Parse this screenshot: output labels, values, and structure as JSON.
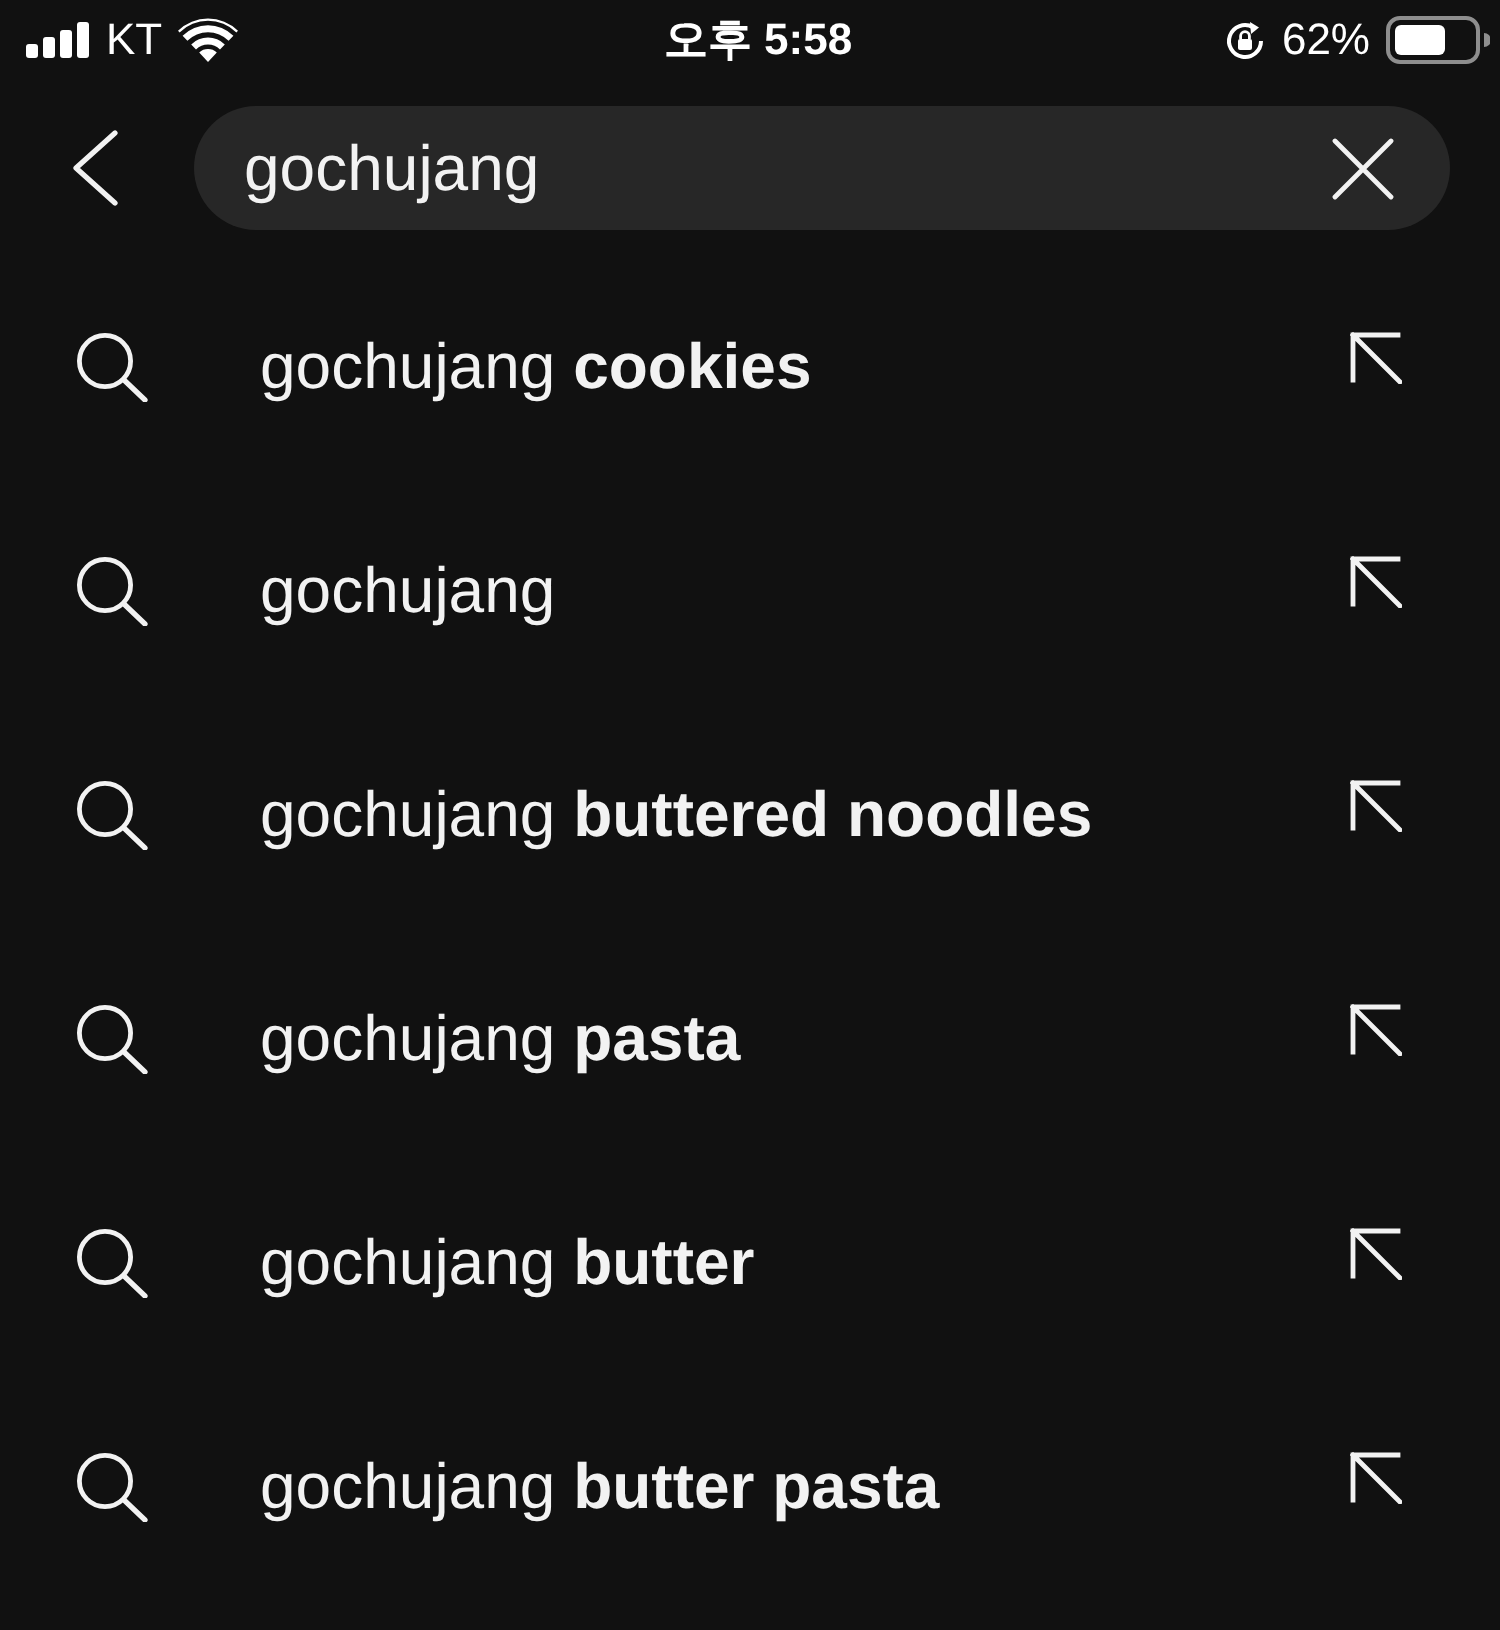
{
  "status_bar": {
    "carrier": "KT",
    "time": "오후 5:58",
    "battery": "62%"
  },
  "search": {
    "value": "gochujang"
  },
  "suggestions": [
    {
      "text": "gochujang **cookies**"
    },
    {
      "text": "gochujang"
    },
    {
      "text": "gochujang **buttered noodles**"
    },
    {
      "text": "gochujang **pasta**"
    },
    {
      "text": "gochujang **butter**"
    },
    {
      "text": "gochujang **butter pasta**"
    }
  ]
}
